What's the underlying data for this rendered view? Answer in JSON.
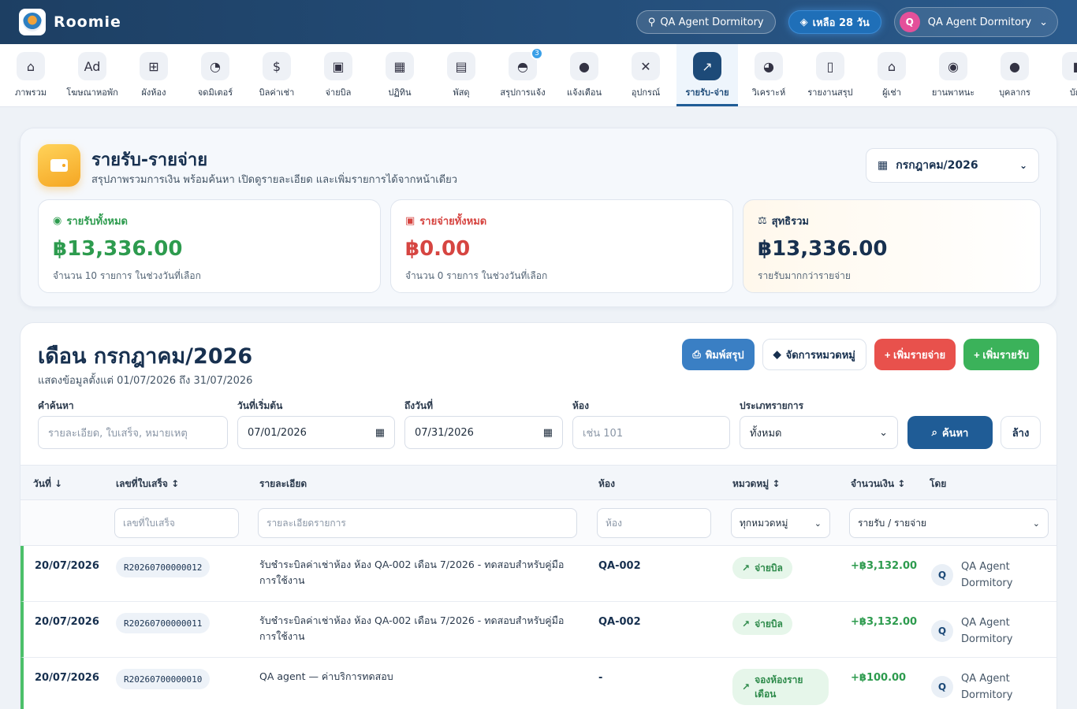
{
  "app": {
    "name": "Roomie"
  },
  "header": {
    "dorm_pill": "QA Agent Dormitory",
    "days_left": "เหลือ 28 วัน",
    "user_initial": "Q",
    "user_name": "QA Agent Dormitory"
  },
  "nav": {
    "items": [
      {
        "label": "ภาพรวม",
        "icon": "⌂"
      },
      {
        "label": "โฆษณาหอพัก",
        "icon": "Ad"
      },
      {
        "label": "ผังห้อง",
        "icon": "⊞"
      },
      {
        "label": "จดมิเตอร์",
        "icon": "◔"
      },
      {
        "label": "บิลค่าเช่า",
        "icon": "$"
      },
      {
        "label": "จ่ายบิล",
        "icon": "▣"
      },
      {
        "label": "ปฏิทิน",
        "icon": "▦"
      },
      {
        "label": "พัสดุ",
        "icon": "▤"
      },
      {
        "label": "สรุปการแจ้ง",
        "icon": "◓",
        "badge": "3"
      },
      {
        "label": "แจ้งเตือน",
        "icon": "●"
      },
      {
        "label": "อุปกรณ์",
        "icon": "✕"
      },
      {
        "label": "รายรับ-จ่าย",
        "icon": "↗",
        "active": true
      },
      {
        "label": "วิเคราะห์",
        "icon": "◕"
      },
      {
        "label": "รายงานสรุป",
        "icon": "▯"
      },
      {
        "label": "ผู้เช่า",
        "icon": "⌂"
      },
      {
        "label": "ยานพาหนะ",
        "icon": "◉"
      },
      {
        "label": "บุคลากร",
        "icon": "●"
      },
      {
        "label": "บัญ",
        "icon": "▮"
      }
    ]
  },
  "summary": {
    "title": "รายรับ-รายจ่าย",
    "subtitle": "สรุปภาพรวมการเงิน พร้อมค้นหา เปิดดูรายละเอียด และเพิ่มรายการได้จากหน้าเดียว",
    "month": "กรกฎาคม/2026",
    "income": {
      "label": "รายรับทั้งหมด",
      "value": "฿13,336.00",
      "note": "จำนวน 10 รายการ ในช่วงวันที่เลือก"
    },
    "expense": {
      "label": "รายจ่ายทั้งหมด",
      "value": "฿0.00",
      "note": "จำนวน 0 รายการ ในช่วงวันที่เลือก"
    },
    "net": {
      "label": "สุทธิรวม",
      "value": "฿13,336.00",
      "note": "รายรับมากกว่ารายจ่าย"
    }
  },
  "table_card": {
    "title": "เดือน กรกฎาคม/2026",
    "subtitle": "แสดงข้อมูลตั้งแต่ 01/07/2026 ถึง 31/07/2026",
    "buttons": {
      "print": "พิมพ์สรุป",
      "categories": "จัดการหมวดหมู่",
      "add_expense": "+ เพิ่มรายจ่าย",
      "add_income": "+ เพิ่มรายรับ"
    },
    "filters": {
      "keyword_label": "คำค้นหา",
      "keyword_placeholder": "รายละเอียด, ใบเสร็จ, หมายเหตุ",
      "start_label": "วันที่เริ่มต้น",
      "start_value": "07/01/2026",
      "end_label": "ถึงวันที่",
      "end_value": "07/31/2026",
      "room_label": "ห้อง",
      "room_placeholder": "เช่น 101",
      "type_label": "ประเภทรายการ",
      "type_value": "ทั้งหมด",
      "search_button": "ค้นหา",
      "clear_button": "ล้าง"
    },
    "columns": {
      "date": "วันที่ ↓",
      "receipt": "เลขที่ใบเสร็จ ↕",
      "detail": "รายละเอียด",
      "room": "ห้อง",
      "category": "หมวดหมู่ ↕",
      "amount": "จำนวนเงิน ↕",
      "by": "โดย"
    },
    "column_filters": {
      "receipt_placeholder": "เลขที่ใบเสร็จ",
      "detail_placeholder": "รายละเอียดรายการ",
      "room_placeholder": "ห้อง",
      "category_value": "ทุกหมวดหมู่",
      "type_value": "รายรับ / รายจ่าย"
    },
    "rows": [
      {
        "date": "20/07/2026",
        "receipt": "R20260700000012",
        "detail": "รับชำระบิลค่าเช่าห้อง ห้อง QA-002 เดือน 7/2026 - ทดสอบสำหรับคู่มือการใช้งาน",
        "room": "QA-002",
        "category": "จ่ายบิล",
        "amount": "+฿3,132.00",
        "by_initial": "Q",
        "by": "QA Agent Dormitory"
      },
      {
        "date": "20/07/2026",
        "receipt": "R20260700000011",
        "detail": "รับชำระบิลค่าเช่าห้อง ห้อง QA-002 เดือน 7/2026 - ทดสอบสำหรับคู่มือการใช้งาน",
        "room": "QA-002",
        "category": "จ่ายบิล",
        "amount": "+฿3,132.00",
        "by_initial": "Q",
        "by": "QA Agent Dormitory"
      },
      {
        "date": "20/07/2026",
        "receipt": "R20260700000010",
        "detail": "QA agent — ค่าบริการทดสอบ",
        "room": "-",
        "category": "จองห้องรายเดือน",
        "amount": "+฿100.00",
        "by_initial": "Q",
        "by": "QA Agent Dormitory"
      }
    ]
  }
}
